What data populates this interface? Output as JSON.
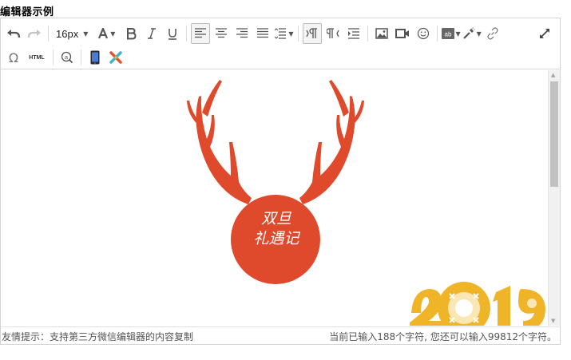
{
  "page": {
    "title": "编辑器示例"
  },
  "toolbar": {
    "font_size": "16px",
    "html_label": "HTML",
    "icons": {
      "undo": "undo-icon",
      "redo": "redo-icon",
      "font_color": "font-color-icon",
      "bold": "bold-icon",
      "italic": "italic-icon",
      "underline": "underline-icon",
      "align_left": "align-left-icon",
      "align_center": "align-center-icon",
      "align_right": "align-right-icon",
      "justify": "justify-icon",
      "line_height": "line-height-icon",
      "ltr": "ltr-icon",
      "rtl": "rtl-icon",
      "indent": "indent-icon",
      "image": "image-icon",
      "video": "video-icon",
      "emoticon": "emoticon-icon",
      "background": "background-color-icon",
      "format_painter": "format-painter-icon",
      "link": "link-icon",
      "fullscreen": "fullscreen-icon",
      "special_char": "omega-icon",
      "preview": "preview-icon",
      "mobile": "mobile-icon",
      "plugin": "plugin-icon"
    }
  },
  "content": {
    "card_text_line1": "双旦",
    "card_text_line2": "礼遇记",
    "deco_year": "2019",
    "accent_color": "#e04a2c",
    "year_color": "#f0b429"
  },
  "status": {
    "hint": "友情提示：支持第三方微信编辑器的内容复制",
    "counter": "当前已输入188个字符, 您还可以输入99812个字符。"
  }
}
